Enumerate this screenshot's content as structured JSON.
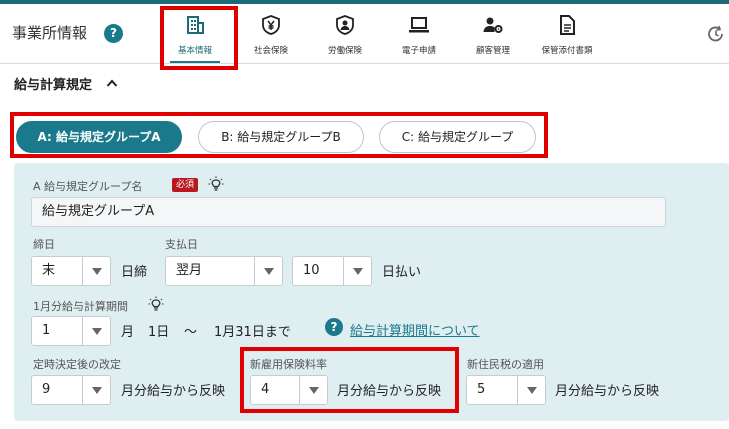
{
  "header": {
    "app_title": "事業所情報",
    "help_glyph": "?",
    "nav": [
      {
        "label": "基本情報",
        "icon": "building-icon",
        "active": true
      },
      {
        "label": "社会保険",
        "icon": "yen-shield-icon",
        "active": false
      },
      {
        "label": "労働保険",
        "icon": "person-shield-icon",
        "active": false
      },
      {
        "label": "電子申請",
        "icon": "laptop-icon",
        "active": false
      },
      {
        "label": "顧客管理",
        "icon": "user-gear-icon",
        "active": false
      },
      {
        "label": "保管添付書類",
        "icon": "document-icon",
        "active": false
      }
    ],
    "history_icon": "history-icon"
  },
  "section": {
    "title": "給与計算規定",
    "toggle_icon": "chevron-up-icon"
  },
  "tabs": [
    {
      "label": "A: 給与規定グループA",
      "active": true
    },
    {
      "label": "B: 給与規定グループB",
      "active": false
    },
    {
      "label": "C: 給与規定グループ",
      "active": false
    }
  ],
  "form": {
    "group_name": {
      "label": "A 給与規定グループ名",
      "required_badge": "必須",
      "value": "給与規定グループA"
    },
    "closing": {
      "label": "締日",
      "value": "末",
      "suffix": "日締"
    },
    "payday": {
      "label": "支払日",
      "month_value": "翌月",
      "day_value": "10",
      "suffix": "日払い"
    },
    "period": {
      "label": "1月分給与計算期間",
      "start_month": "1",
      "month_unit": "月",
      "start_day": "1日",
      "tilde": "～",
      "end_text": "1月31日まで",
      "help_glyph": "?",
      "link_text": "給与計算期間について"
    },
    "revision": {
      "label": "定時決定後の改定",
      "value": "9",
      "suffix": "月分給与から反映"
    },
    "employment_insurance": {
      "label": "新雇用保険料率",
      "value": "4",
      "suffix": "月分給与から反映"
    },
    "resident_tax": {
      "label": "新住民税の適用",
      "value": "5",
      "suffix": "月分給与から反映"
    }
  },
  "colors": {
    "accent": "#1a7a8c",
    "panel_bg": "#dfeef0",
    "required": "#b8191f",
    "highlight": "#e00000"
  }
}
